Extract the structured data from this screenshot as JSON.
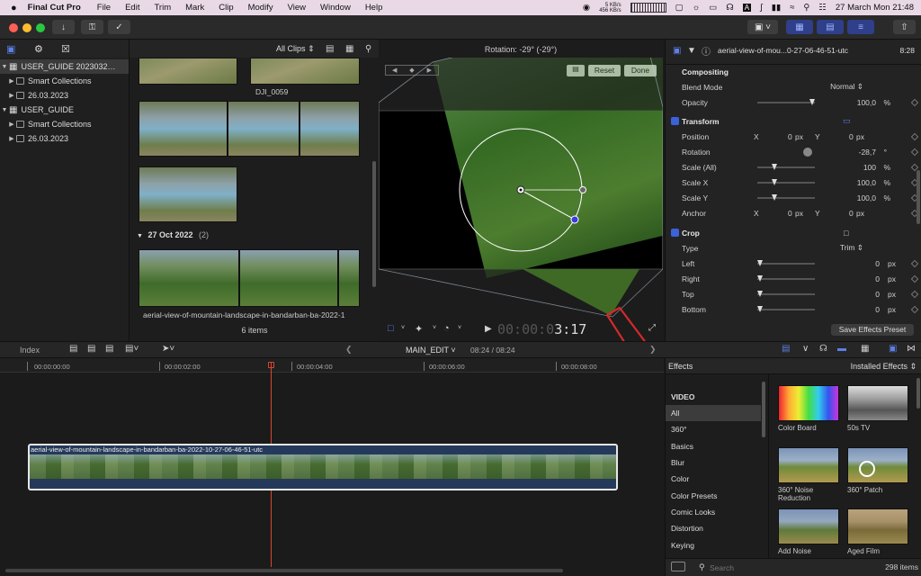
{
  "menubar": {
    "apple": "",
    "app_name": "Final Cut Pro",
    "items": [
      "File",
      "Edit",
      "Trim",
      "Mark",
      "Clip",
      "Modify",
      "View",
      "Window",
      "Help"
    ],
    "net_up": "5 KB/s",
    "net_down": "456 KB/s",
    "datetime": "27 March Mon  21:48"
  },
  "library": {
    "rows": [
      {
        "label": "USER_GUIDE 2023032…",
        "level": 0,
        "expanded": true,
        "selected": true
      },
      {
        "label": "Smart Collections",
        "level": 1,
        "expanded": false
      },
      {
        "label": "26.03.2023",
        "level": 1,
        "expanded": false
      },
      {
        "label": "USER_GUIDE",
        "level": 0,
        "expanded": true
      },
      {
        "label": "Smart Collections",
        "level": 1,
        "expanded": false
      },
      {
        "label": "26.03.2023",
        "level": 1,
        "expanded": false
      }
    ]
  },
  "browser": {
    "filter": "All Clips",
    "clip_label_1": "DJI_0059",
    "date_group": "27 Oct 2022",
    "date_group_count": "(2)",
    "clip_label_2": "aerial-view-of-mountain-landscape-in-bandarban-ba-2022-1",
    "item_count": "6 items"
  },
  "viewer": {
    "title": "Rotation: -29° (-29°)",
    "reset": "Reset",
    "done": "Done",
    "timecode_dim": "00:00:0",
    "timecode": "3:17"
  },
  "inspector": {
    "clip_name": "aerial-view-of-mou...0-27-06-46-51-utc",
    "duration": "8:28",
    "compositing": "Compositing",
    "blend_mode_label": "Blend Mode",
    "blend_mode_value": "Normal",
    "opacity_label": "Opacity",
    "opacity_value": "100,0",
    "opacity_unit": "%",
    "transform": "Transform",
    "position_label": "Position",
    "pos_x_label": "X",
    "pos_x": "0",
    "pos_y_label": "Y",
    "pos_y": "0",
    "px": "px",
    "rotation_label": "Rotation",
    "rotation_value": "-28,7",
    "rotation_unit": "°",
    "scale_all_label": "Scale (All)",
    "scale_all": "100",
    "scale_x_label": "Scale X",
    "scale_x": "100,0",
    "scale_y_label": "Scale Y",
    "scale_y": "100,0",
    "anchor_label": "Anchor",
    "anc_x": "0",
    "anc_y": "0",
    "crop": "Crop",
    "type_label": "Type",
    "type_value": "Trim",
    "left_label": "Left",
    "left_value": "0",
    "right_label": "Right",
    "right_value": "0",
    "top_label": "Top",
    "top_value": "0",
    "bottom_label": "Bottom",
    "bottom_value": "0",
    "save_preset": "Save Effects Preset"
  },
  "timeline_bar": {
    "index": "Index",
    "project": "MAIN_EDIT",
    "duration": "08:24 / 08:24"
  },
  "timeline": {
    "ticks": [
      "00:00:00:00",
      "00:00:02:00",
      "00:00:04:00",
      "00:00:06:00",
      "00:00:08:00"
    ],
    "clip_name": "aerial-view-of-mountain-landscape-in-bandarban-ba-2022-10-27-06-46-51-utc"
  },
  "effects": {
    "title": "Effects",
    "installed": "Installed Effects",
    "section": "VIDEO",
    "categories": [
      "All",
      "360°",
      "Basics",
      "Blur",
      "Color",
      "Color Presets",
      "Comic Looks",
      "Distortion",
      "Keying"
    ],
    "items": [
      {
        "name": "Color Board"
      },
      {
        "name": "50s TV"
      },
      {
        "name": "360° Noise Reduction"
      },
      {
        "name": "360° Patch"
      },
      {
        "name": "Add Noise"
      },
      {
        "name": "Aged Film"
      }
    ],
    "search_placeholder": "Search",
    "count": "298 items"
  },
  "colors": {
    "accent": "#3b62d6",
    "annotation_arrow": "#d42a2a",
    "menubar": "#e9d9e6"
  }
}
